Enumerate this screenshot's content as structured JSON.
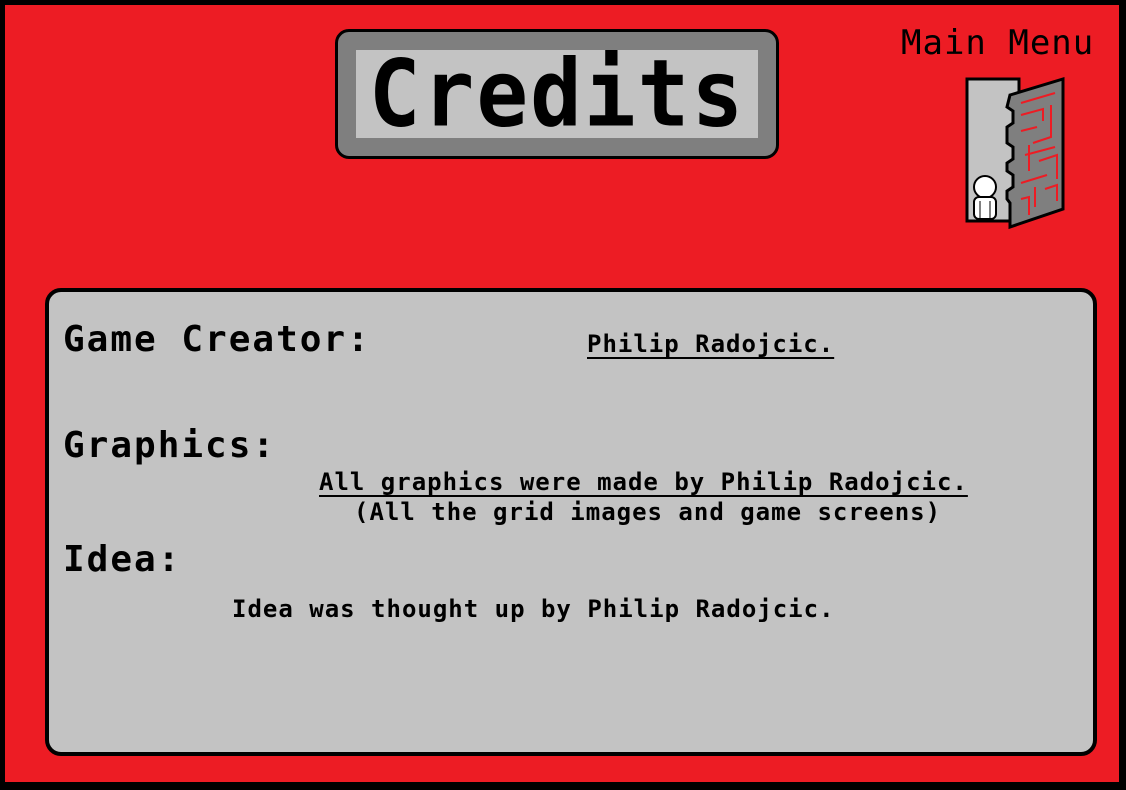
{
  "title": "Credits",
  "nav": {
    "main_menu_label": "Main Menu"
  },
  "credits": {
    "game_creator": {
      "heading": "Game Creator:",
      "value": "Philip Radojcic."
    },
    "graphics": {
      "heading": "Graphics:",
      "value": "All graphics were made by Philip Radojcic.",
      "note": "(All the grid images and game screens)"
    },
    "idea": {
      "heading": "Idea:",
      "value": "Idea was thought up by Philip Radojcic."
    }
  },
  "colors": {
    "background": "#ed1c24",
    "panel": "#c3c3c3",
    "frame": "#7f7f7f",
    "text": "#000000"
  },
  "icons": {
    "main_menu": "door-with-maze-and-figure-icon"
  }
}
